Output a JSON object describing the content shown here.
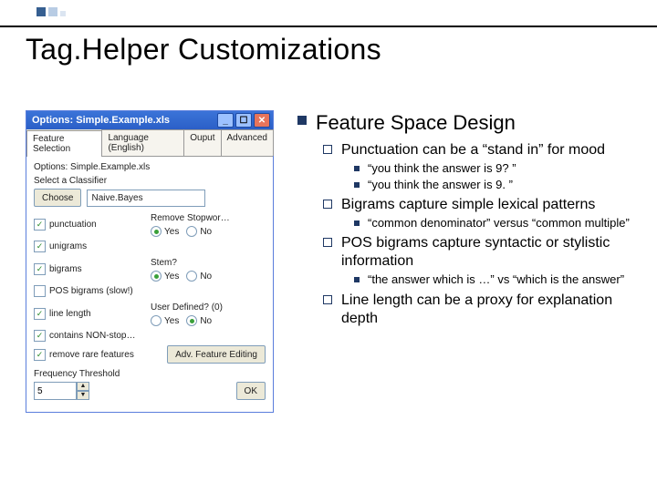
{
  "title": "Tag.Helper Customizations",
  "outline": {
    "l1": "Feature Space Design",
    "items": [
      {
        "text": "Punctuation can be a “stand in” for mood",
        "sub": [
          "“you think the answer is 9? ”",
          "“you think the answer is 9. ”"
        ]
      },
      {
        "text": "Bigrams capture simple lexical patterns",
        "sub": [
          "“common denominator” versus “common multiple”"
        ]
      },
      {
        "text": "POS bigrams capture syntactic or stylistic information",
        "sub": [
          "“the answer which is …” vs  “which is the answer”"
        ]
      },
      {
        "text": "Line length can be a proxy for explanation depth",
        "sub": []
      }
    ]
  },
  "win": {
    "title": "Options: Simple.Example.xls",
    "tabs": [
      "Feature Selection",
      "Language (English)",
      "Ouput",
      "Advanced"
    ],
    "subtitle": "Options: Simple.Example.xls",
    "classifier_label": "Select a Classifier",
    "choose": "Choose",
    "classifier": "Naive.Bayes",
    "left_checks": [
      "punctuation",
      "unigrams",
      "bigrams",
      "POS bigrams (slow!)",
      "line length",
      "contains NON-stop…",
      "remove rare features"
    ],
    "right": {
      "stop_label": "Remove Stopwor…",
      "stem_label": "Stem?",
      "user_label": "User Defined? (0)",
      "yes": "Yes",
      "no": "No"
    },
    "adv_btn": "Adv. Feature Editing",
    "ok_btn": "OK",
    "freq_label": "Frequency Threshold",
    "freq_val": "5"
  }
}
